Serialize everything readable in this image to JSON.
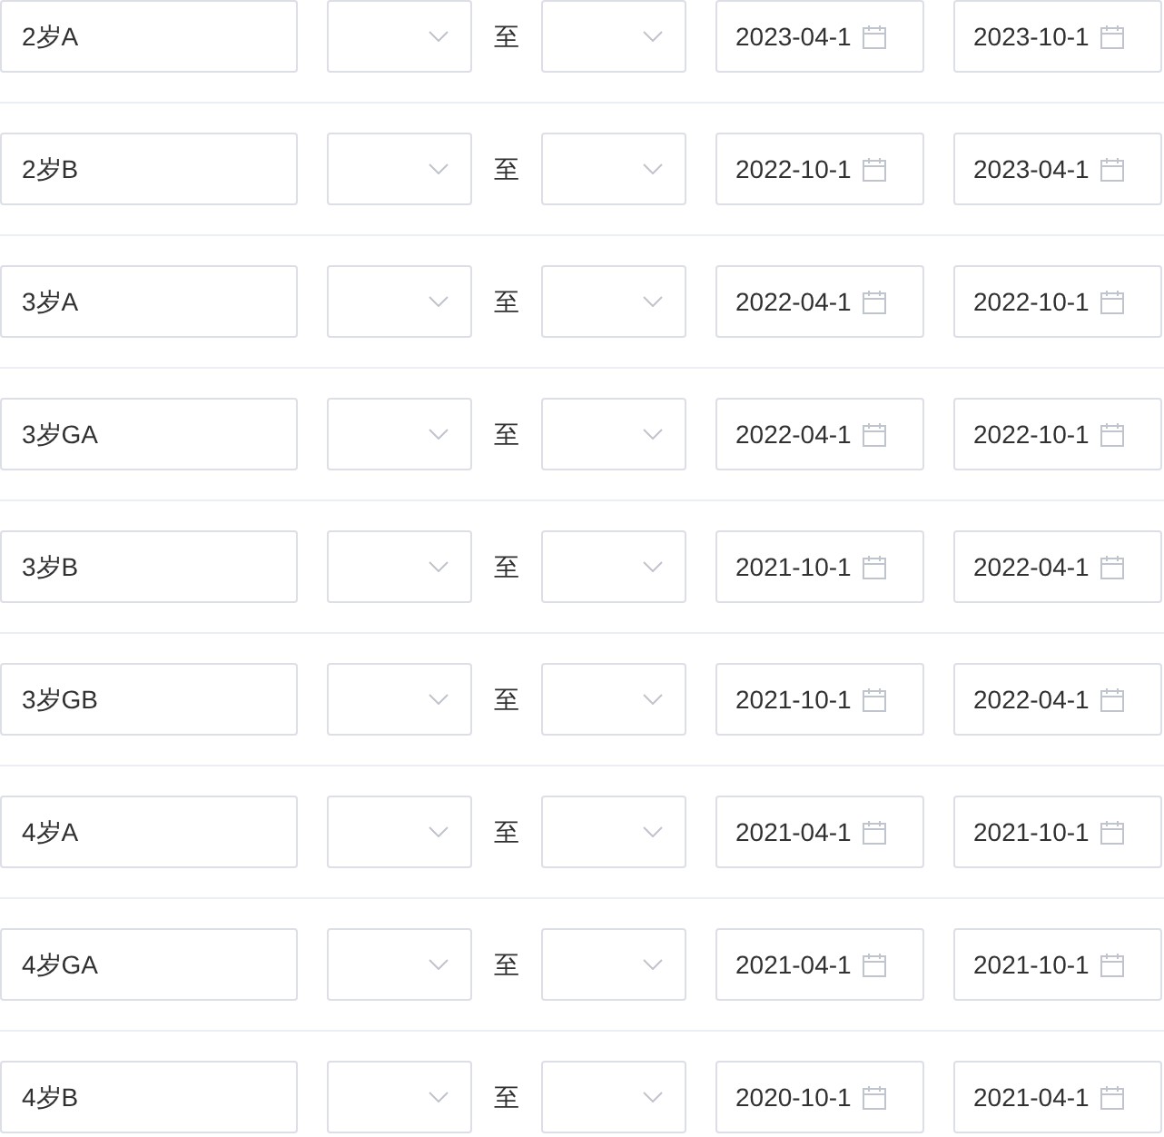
{
  "rows": [
    {
      "name": "2岁A",
      "separator": "至",
      "start_date": "2023-04-1",
      "end_date": "2023-10-1"
    },
    {
      "name": "2岁B",
      "separator": "至",
      "start_date": "2022-10-1",
      "end_date": "2023-04-1"
    },
    {
      "name": "3岁A",
      "separator": "至",
      "start_date": "2022-04-1",
      "end_date": "2022-10-1"
    },
    {
      "name": "3岁GA",
      "separator": "至",
      "start_date": "2022-04-1",
      "end_date": "2022-10-1"
    },
    {
      "name": "3岁B",
      "separator": "至",
      "start_date": "2021-10-1",
      "end_date": "2022-04-1"
    },
    {
      "name": "3岁GB",
      "separator": "至",
      "start_date": "2021-10-1",
      "end_date": "2022-04-1"
    },
    {
      "name": "4岁A",
      "separator": "至",
      "start_date": "2021-04-1",
      "end_date": "2021-10-1"
    },
    {
      "name": "4岁GA",
      "separator": "至",
      "start_date": "2021-04-1",
      "end_date": "2021-10-1"
    },
    {
      "name": "4岁B",
      "separator": "至",
      "start_date": "2020-10-1",
      "end_date": "2021-04-1"
    }
  ]
}
